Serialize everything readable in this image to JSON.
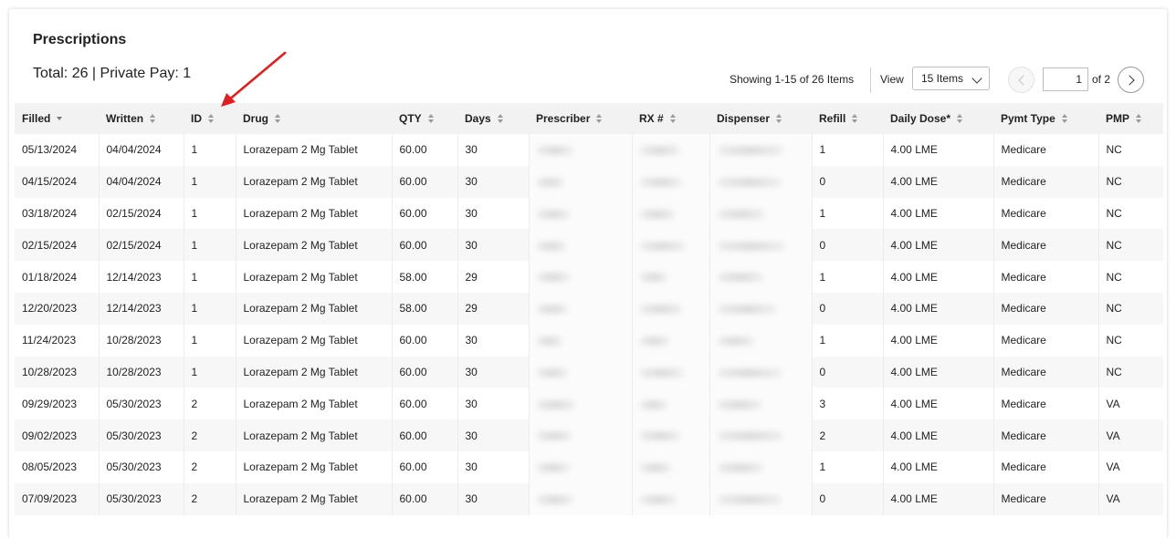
{
  "panel": {
    "title": "Prescriptions",
    "summary": "Total: 26 | Private Pay: 1"
  },
  "pagination": {
    "showing": "Showing 1-15 of 26 Items",
    "view_label": "View",
    "items_per_page": "15 Items",
    "current_page": "1",
    "of_pages": "of 2"
  },
  "columns": [
    "Filled",
    "Written",
    "ID",
    "Drug",
    "QTY",
    "Days",
    "Prescriber",
    "RX #",
    "Dispenser",
    "Refill",
    "Daily Dose*",
    "Pymt Type",
    "PMP"
  ],
  "rows": [
    {
      "filled": "05/13/2024",
      "written": "04/04/2024",
      "id": "1",
      "drug": "Lorazepam 2 Mg Tablet",
      "qty": "60.00",
      "days": "30",
      "refill": "1",
      "daily_dose": "4.00 LME",
      "pymt_type": "Medicare",
      "pmp": "NC"
    },
    {
      "filled": "04/15/2024",
      "written": "04/04/2024",
      "id": "1",
      "drug": "Lorazepam 2 Mg Tablet",
      "qty": "60.00",
      "days": "30",
      "refill": "0",
      "daily_dose": "4.00 LME",
      "pymt_type": "Medicare",
      "pmp": "NC"
    },
    {
      "filled": "03/18/2024",
      "written": "02/15/2024",
      "id": "1",
      "drug": "Lorazepam 2 Mg Tablet",
      "qty": "60.00",
      "days": "30",
      "refill": "1",
      "daily_dose": "4.00 LME",
      "pymt_type": "Medicare",
      "pmp": "NC"
    },
    {
      "filled": "02/15/2024",
      "written": "02/15/2024",
      "id": "1",
      "drug": "Lorazepam 2 Mg Tablet",
      "qty": "60.00",
      "days": "30",
      "refill": "0",
      "daily_dose": "4.00 LME",
      "pymt_type": "Medicare",
      "pmp": "NC"
    },
    {
      "filled": "01/18/2024",
      "written": "12/14/2023",
      "id": "1",
      "drug": "Lorazepam 2 Mg Tablet",
      "qty": "58.00",
      "days": "29",
      "refill": "1",
      "daily_dose": "4.00 LME",
      "pymt_type": "Medicare",
      "pmp": "NC"
    },
    {
      "filled": "12/20/2023",
      "written": "12/14/2023",
      "id": "1",
      "drug": "Lorazepam 2 Mg Tablet",
      "qty": "58.00",
      "days": "29",
      "refill": "0",
      "daily_dose": "4.00 LME",
      "pymt_type": "Medicare",
      "pmp": "NC"
    },
    {
      "filled": "11/24/2023",
      "written": "10/28/2023",
      "id": "1",
      "drug": "Lorazepam 2 Mg Tablet",
      "qty": "60.00",
      "days": "30",
      "refill": "1",
      "daily_dose": "4.00 LME",
      "pymt_type": "Medicare",
      "pmp": "NC"
    },
    {
      "filled": "10/28/2023",
      "written": "10/28/2023",
      "id": "1",
      "drug": "Lorazepam 2 Mg Tablet",
      "qty": "60.00",
      "days": "30",
      "refill": "0",
      "daily_dose": "4.00 LME",
      "pymt_type": "Medicare",
      "pmp": "NC"
    },
    {
      "filled": "09/29/2023",
      "written": "05/30/2023",
      "id": "2",
      "drug": "Lorazepam 2 Mg Tablet",
      "qty": "60.00",
      "days": "30",
      "refill": "3",
      "daily_dose": "4.00 LME",
      "pymt_type": "Medicare",
      "pmp": "VA"
    },
    {
      "filled": "09/02/2023",
      "written": "05/30/2023",
      "id": "2",
      "drug": "Lorazepam 2 Mg Tablet",
      "qty": "60.00",
      "days": "30",
      "refill": "2",
      "daily_dose": "4.00 LME",
      "pymt_type": "Medicare",
      "pmp": "VA"
    },
    {
      "filled": "08/05/2023",
      "written": "05/30/2023",
      "id": "2",
      "drug": "Lorazepam 2 Mg Tablet",
      "qty": "60.00",
      "days": "30",
      "refill": "1",
      "daily_dose": "4.00 LME",
      "pymt_type": "Medicare",
      "pmp": "VA"
    },
    {
      "filled": "07/09/2023",
      "written": "05/30/2023",
      "id": "2",
      "drug": "Lorazepam 2 Mg Tablet",
      "qty": "60.00",
      "days": "30",
      "refill": "0",
      "daily_dose": "4.00 LME",
      "pymt_type": "Medicare",
      "pmp": "VA"
    }
  ],
  "sort_column": "Filled",
  "icons": {
    "sort": "sort-icon",
    "prev": "chevron-left-icon",
    "next": "chevron-right-icon",
    "dropdown": "chevron-down-icon",
    "annotation": "red-arrow-icon"
  },
  "colors": {
    "header_bg": "#f2f2f2",
    "alt_row": "#f7f7f7",
    "annotation_arrow": "#e02020"
  }
}
